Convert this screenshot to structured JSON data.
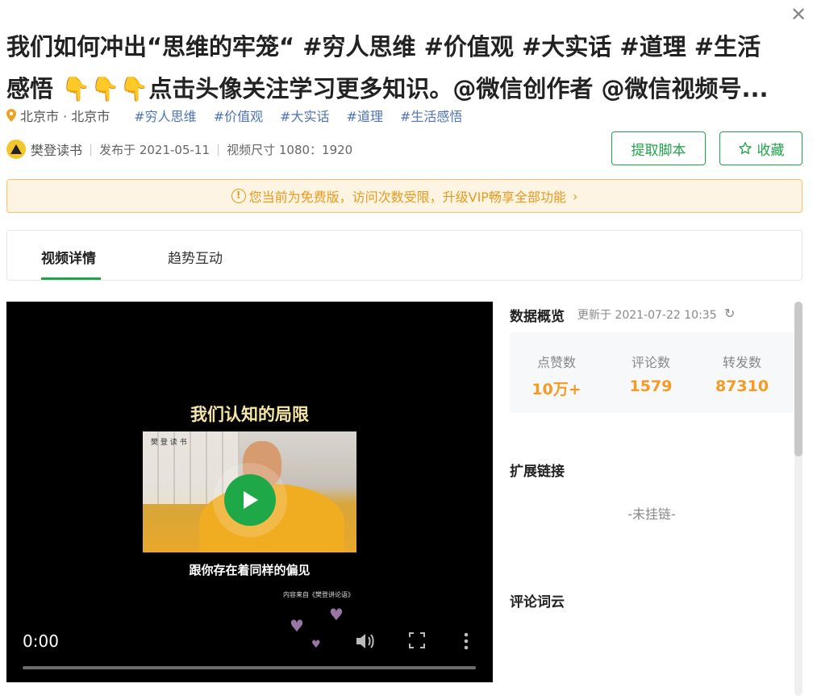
{
  "close_icon": "close-icon",
  "title": {
    "line1": "我们如何冲出“思维的牢笼“ #穷人思维 #价值观 #大实话 #道理 #生活",
    "line2": "感悟 👇👇👇点击头像关注学习更多知识。@微信创作者 @微信视频号..."
  },
  "meta": {
    "location": "北京市 · 北京市",
    "tags": [
      "#穷人思维",
      "#价值观",
      "#大实话",
      "#道理",
      "#生活感悟"
    ]
  },
  "author_row": {
    "author": "樊登读书",
    "published": "发布于 2021-05-11",
    "size": "视频尺寸 1080：1920"
  },
  "buttons": {
    "script": "提取脚本",
    "favorite": "收藏"
  },
  "notice": {
    "text": "您当前为免费版，访问次数受限，升级VIP畅享全部功能"
  },
  "tabs": [
    "视频详情",
    "趋势互动"
  ],
  "video": {
    "caption_top": "我们认知的局限",
    "caption_bottom": "跟你存在着同样的偏见",
    "source": "内容来自《樊登讲论语》",
    "logo": "樊 登 读 书",
    "time": "0:00"
  },
  "overview": {
    "heading": "数据概览",
    "updated": "更新于 2021-07-22 10:35",
    "stats": [
      {
        "label": "点赞数",
        "value": "10万+"
      },
      {
        "label": "评论数",
        "value": "1579"
      },
      {
        "label": "转发数",
        "value": "87310"
      }
    ]
  },
  "extension": {
    "heading": "扩展链接",
    "empty": "-未挂链-"
  },
  "cloud": {
    "heading": "评论词云"
  },
  "colors": {
    "accent": "#20a34a",
    "tag": "#4e73b8",
    "stat": "#f59a23",
    "notice": "#e59a1c"
  }
}
